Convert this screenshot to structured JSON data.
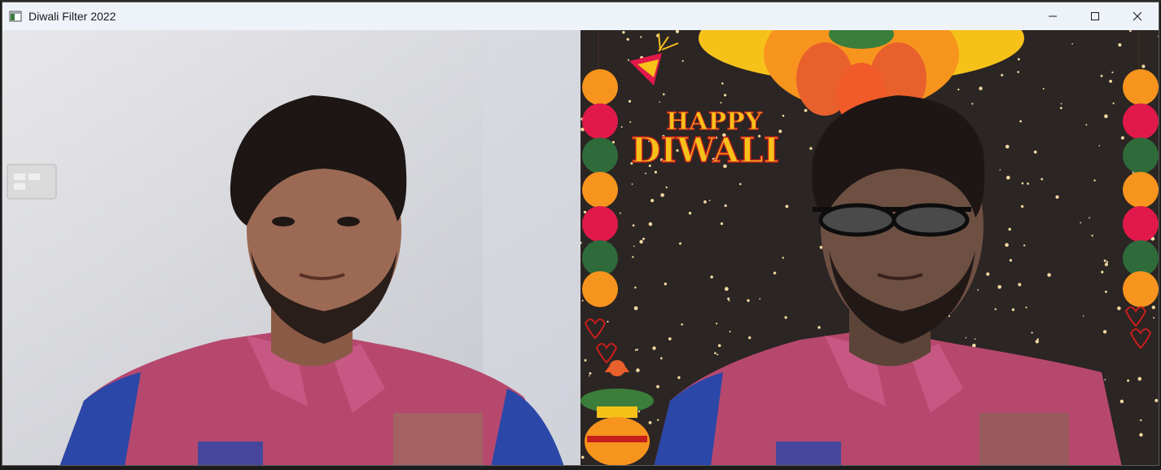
{
  "window": {
    "title": "Diwali Filter 2022",
    "icon": "app-window-icon",
    "controls": [
      "minimize-icon",
      "maximize-icon",
      "close-icon"
    ]
  },
  "left_feed": {
    "description_icon": "webcam-feed"
  },
  "right_feed": {
    "banner_line1": "HAPPY",
    "banner_line2": "DIWALI",
    "colors": {
      "background": "#2b2524",
      "gold": "#f6c21a",
      "banner_red": "#c71f1c",
      "marigold": "#f7941d",
      "rose": "#e0194a",
      "leaf": "#2f6b3a"
    }
  }
}
